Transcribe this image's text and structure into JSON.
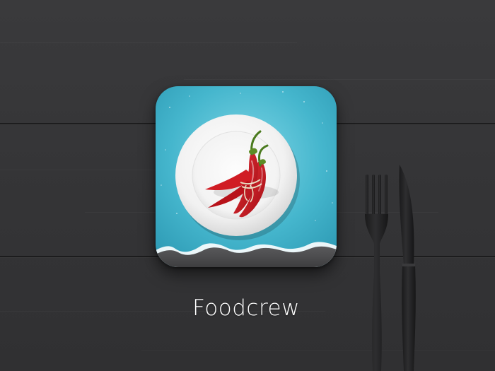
{
  "app": {
    "name": "Foodcrew"
  },
  "colors": {
    "table_wood": "#353537",
    "icon_sky": "#46b8cf",
    "icon_ground": "#4a4a4c",
    "plate": "#f2f2f2",
    "chili": "#c8141c",
    "label_text": "#ffffff"
  },
  "icons": [
    "app-icon",
    "plate-icon",
    "chili-peppers-icon",
    "fork-icon",
    "knife-icon"
  ]
}
